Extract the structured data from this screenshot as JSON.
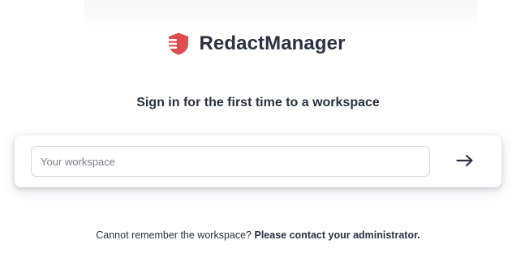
{
  "brand": {
    "name": "RedactManager",
    "logo_icon": "redact-shield-icon",
    "logo_color": "#dd4d50"
  },
  "signin": {
    "heading": "Sign in for the first time to a workspace",
    "workspace_placeholder": "Your workspace",
    "workspace_value": "",
    "submit_icon": "arrow-right-icon"
  },
  "footer": {
    "prompt": "Cannot remember the workspace?",
    "contact": "Please contact your administrator."
  },
  "colors": {
    "text": "#283241",
    "accent": "#dd4d50",
    "input_border": "#d6d8dc",
    "placeholder": "#7a808a"
  }
}
